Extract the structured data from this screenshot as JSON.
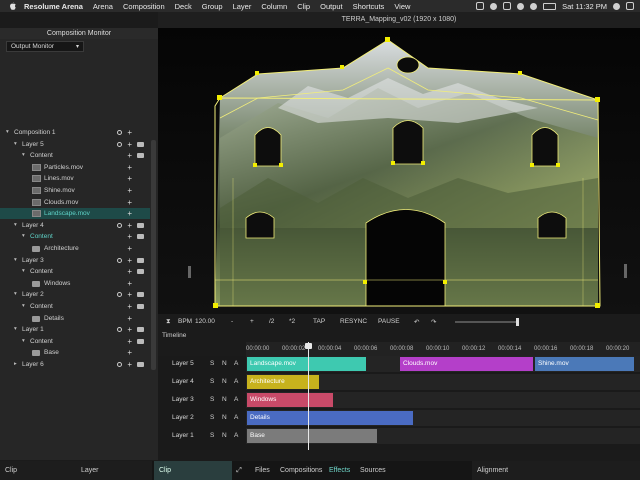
{
  "menubar": {
    "app_name": "Resolume Arena",
    "items": [
      "Arena",
      "Composition",
      "Deck",
      "Group",
      "Layer",
      "Column",
      "Clip",
      "Output",
      "Shortcuts",
      "View"
    ],
    "clock": "Sat 11:32 PM"
  },
  "left_panel": {
    "title": "Composition Monitor",
    "output_select": "Output Monitor",
    "tree": [
      {
        "label": "Composition 1",
        "level": 0,
        "kind": "comp"
      },
      {
        "label": "Layer 5",
        "level": 1,
        "kind": "layer"
      },
      {
        "label": "Content",
        "level": 2,
        "kind": "content"
      },
      {
        "label": "Particles.mov",
        "level": 3,
        "kind": "clip"
      },
      {
        "label": "Lines.mov",
        "level": 3,
        "kind": "clip"
      },
      {
        "label": "Shine.mov",
        "level": 3,
        "kind": "clip"
      },
      {
        "label": "Clouds.mov",
        "level": 3,
        "kind": "clip"
      },
      {
        "label": "Landscape.mov",
        "level": 3,
        "kind": "clip",
        "selected": true
      },
      {
        "label": "Layer 4",
        "level": 1,
        "kind": "layer"
      },
      {
        "label": "Content",
        "level": 2,
        "kind": "content",
        "highlight": true
      },
      {
        "label": "Architecture",
        "level": 3,
        "kind": "folder"
      },
      {
        "label": "Layer 3",
        "level": 1,
        "kind": "layer"
      },
      {
        "label": "Content",
        "level": 2,
        "kind": "content"
      },
      {
        "label": "Windows",
        "level": 3,
        "kind": "folder"
      },
      {
        "label": "Layer 2",
        "level": 1,
        "kind": "layer"
      },
      {
        "label": "Content",
        "level": 2,
        "kind": "content"
      },
      {
        "label": "Details",
        "level": 3,
        "kind": "folder"
      },
      {
        "label": "Layer 1",
        "level": 1,
        "kind": "layer"
      },
      {
        "label": "Content",
        "level": 2,
        "kind": "content"
      },
      {
        "label": "Base",
        "level": 3,
        "kind": "folder"
      },
      {
        "label": "Layer 6",
        "level": 1,
        "kind": "layer"
      }
    ]
  },
  "output_window": {
    "title": "TERRA_Mapping_v02 (1920 x 1080)"
  },
  "transport": {
    "bpm_label": "BPM",
    "bpm_value": "120.00",
    "minus": "-",
    "plus": "+",
    "div2": "/2",
    "mul2": "*2",
    "tap": "TAP",
    "resync": "RESYNC",
    "pause": "PAUSE",
    "speed_fraction": 1.0
  },
  "timeline": {
    "title": "Timeline",
    "ruler": [
      "00:00:00",
      "00:00:02",
      "00:00:04",
      "00:00:06",
      "00:00:08",
      "00:00:10",
      "00:00:12",
      "00:00:14",
      "00:00:16",
      "00:00:18",
      "00:00:20"
    ],
    "tracks": [
      {
        "name": "Layer 5",
        "clips": [
          {
            "label": "Landscape.mov",
            "color": "#3ec9b0"
          },
          {
            "label": "Clouds.mov",
            "color": "#b43fc9"
          },
          {
            "label": "Shine.mov",
            "color": "#4b79b8"
          }
        ]
      },
      {
        "name": "Layer 4",
        "clips": [
          {
            "label": "Architecture",
            "color": "#c7b21d"
          }
        ]
      },
      {
        "name": "Layer 3",
        "clips": [
          {
            "label": "Windows",
            "color": "#c84a68"
          }
        ]
      },
      {
        "name": "Layer 2",
        "clips": [
          {
            "label": "Details",
            "color": "#4a6bc2"
          }
        ]
      },
      {
        "name": "Layer 1",
        "clips": [
          {
            "label": "Base",
            "color": "#7b7b7b"
          }
        ]
      }
    ],
    "track_flags": [
      "S",
      "N",
      "A"
    ]
  },
  "bottom_tabs": {
    "clip_left": "Clip",
    "layer": "Layer",
    "clip_mid": "Clip",
    "files": "Files",
    "compositions": "Compositions",
    "effects": "Effects",
    "sources": "Sources",
    "alignment": "Alignment"
  }
}
